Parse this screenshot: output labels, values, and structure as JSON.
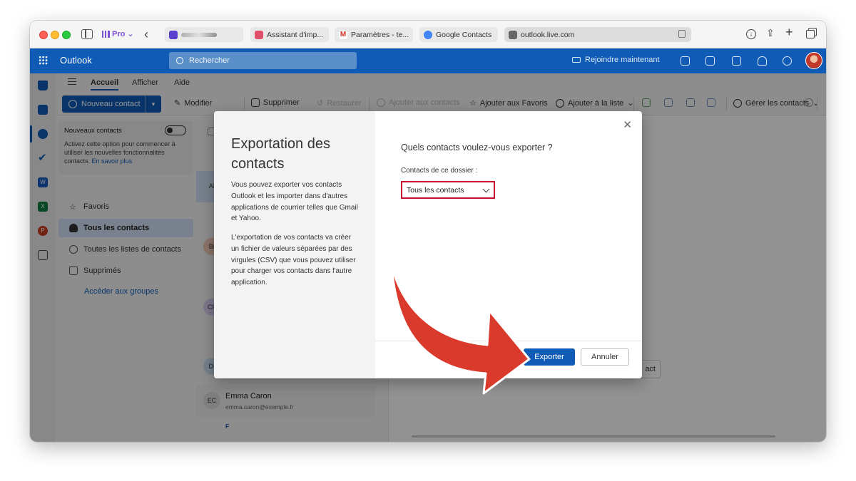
{
  "browser": {
    "profile_label": "Pro",
    "tabs": [
      {
        "label": "",
        "favicon_color": "#5a3fd0"
      },
      {
        "label": "Assistant d'imp...",
        "favicon_color": "#e0506b"
      },
      {
        "label": "Paramètres - te...",
        "favicon_color": "#d93025"
      },
      {
        "label": "Google Contacts",
        "favicon_color": "#4285f4"
      }
    ],
    "url": "outlook.live.com"
  },
  "outlook": {
    "app_title": "Outlook",
    "search_placeholder": "Rechercher",
    "join_now": "Rejoindre maintenant",
    "nav_tabs": [
      "Accueil",
      "Afficher",
      "Aide"
    ],
    "ribbon": {
      "new_contact": "Nouveau contact",
      "edit": "Modifier",
      "delete": "Supprimer",
      "restore": "Restaurer",
      "add_to_contacts": "Ajouter aux contacts",
      "add_to_favorites": "Ajouter aux Favoris",
      "add_to_list": "Ajouter à la liste",
      "manage_contacts": "Gérer les contacts"
    },
    "new_contacts_card": {
      "title": "Nouveaux contacts",
      "text": "Activez cette option pour commencer à utiliser les nouvelles fonctionnalités contacts.",
      "link": "En savoir plus"
    },
    "folders": [
      "Favoris",
      "Tous les contacts",
      "Toutes les listes de contacts",
      "Supprimés"
    ],
    "groups_link": "Accéder aux groupes",
    "contacts": [
      {
        "initials": "AI",
        "name": "",
        "email": "",
        "color": "#cfe0f2"
      },
      {
        "initials": "BI",
        "name": "",
        "email": "",
        "color": "#f0c8b6"
      },
      {
        "initials": "CF",
        "name": "",
        "email": "",
        "color": "#d8cdf0"
      },
      {
        "initials": "DI",
        "name": "",
        "email": "",
        "color": "#c6dcef"
      },
      {
        "initials": "EC",
        "name": "Emma Caron",
        "email": "emma.caron@exemple.fr",
        "color": "#d9d9d9"
      }
    ],
    "section_letter": "F",
    "reading_button": "act"
  },
  "dialog": {
    "title": "Exportation des contacts",
    "para1": "Vous pouvez exporter vos contacts Outlook et les importer dans d'autres applications de courrier telles que Gmail et Yahoo.",
    "para2": "L'exportation de vos contacts va créer un fichier de valeurs séparées par des virgules (CSV) que vous pouvez utiliser pour charger vos contacts dans l'autre application.",
    "question": "Quels contacts voulez-vous exporter ?",
    "folder_label": "Contacts de ce dossier :",
    "selected_option": "Tous les contacts",
    "export_button": "Exporter",
    "cancel_button": "Annuler",
    "close_icon": "close-icon"
  },
  "colors": {
    "brand": "#0f5bb6",
    "highlight": "#c8102e",
    "annotation_arrow": "#d93a2b"
  }
}
